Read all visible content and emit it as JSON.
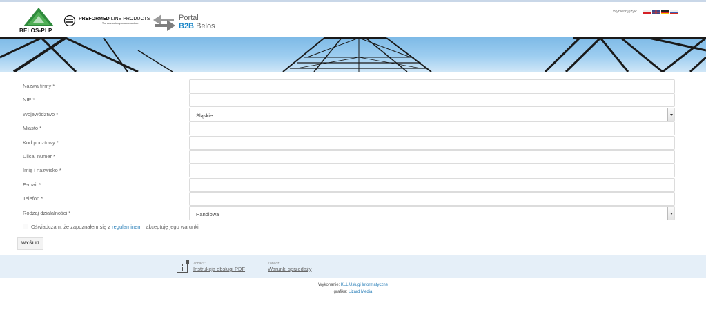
{
  "header": {
    "brand_belos": "BELOS-PLP",
    "brand_plp_bold": "PREFORMED",
    "brand_plp_light": "LINE PRODUCTS",
    "brand_plp_tagline": "The connection you can count on.",
    "portal_title": "Portal",
    "portal_sub_bold": "B2B",
    "portal_sub_rest": "Belos",
    "language_label": "Wybierz język:",
    "flags": [
      "flag-pl-icon",
      "flag-en-icon",
      "flag-de-icon",
      "flag-ru-icon"
    ]
  },
  "form": {
    "fields": [
      {
        "label": "Nazwa firmy *",
        "value": ""
      },
      {
        "label": "NIP *",
        "value": ""
      },
      {
        "label": "Województwo *",
        "value": "Śląskie",
        "type": "select"
      },
      {
        "label": "Miasto *",
        "value": ""
      },
      {
        "label": "Kod pocztowy *",
        "value": ""
      },
      {
        "label": "Ulica, numer *",
        "value": ""
      },
      {
        "label": "Imię i nazwisko *",
        "value": ""
      },
      {
        "label": "E-mail *",
        "value": ""
      },
      {
        "label": "Telefon *",
        "value": ""
      },
      {
        "label": "Rodzaj działalności *",
        "value": "Handlowa",
        "type": "select"
      }
    ],
    "consent_pre": "Oświadczam, że zapoznałem się z",
    "consent_link": "regulaminem",
    "consent_post": "i akceptuję jego warunki.",
    "submit_label": "WYŚLIJ"
  },
  "footer": {
    "left_small": "Zobacz:",
    "left_link": "Instrukcja obsługi PDF",
    "right_small": "Zobacz:",
    "right_link": "Warunki sprzedaży",
    "credit1_label": "Wykonanie:",
    "credit1_link": "KLL Usługi Informatyczne",
    "credit2_label": "grafika:",
    "credit2_link": "Lizard Media"
  },
  "colors": {
    "accent": "#1a86c8",
    "link": "#2a7fb8",
    "footer_band": "#e5eff8"
  }
}
